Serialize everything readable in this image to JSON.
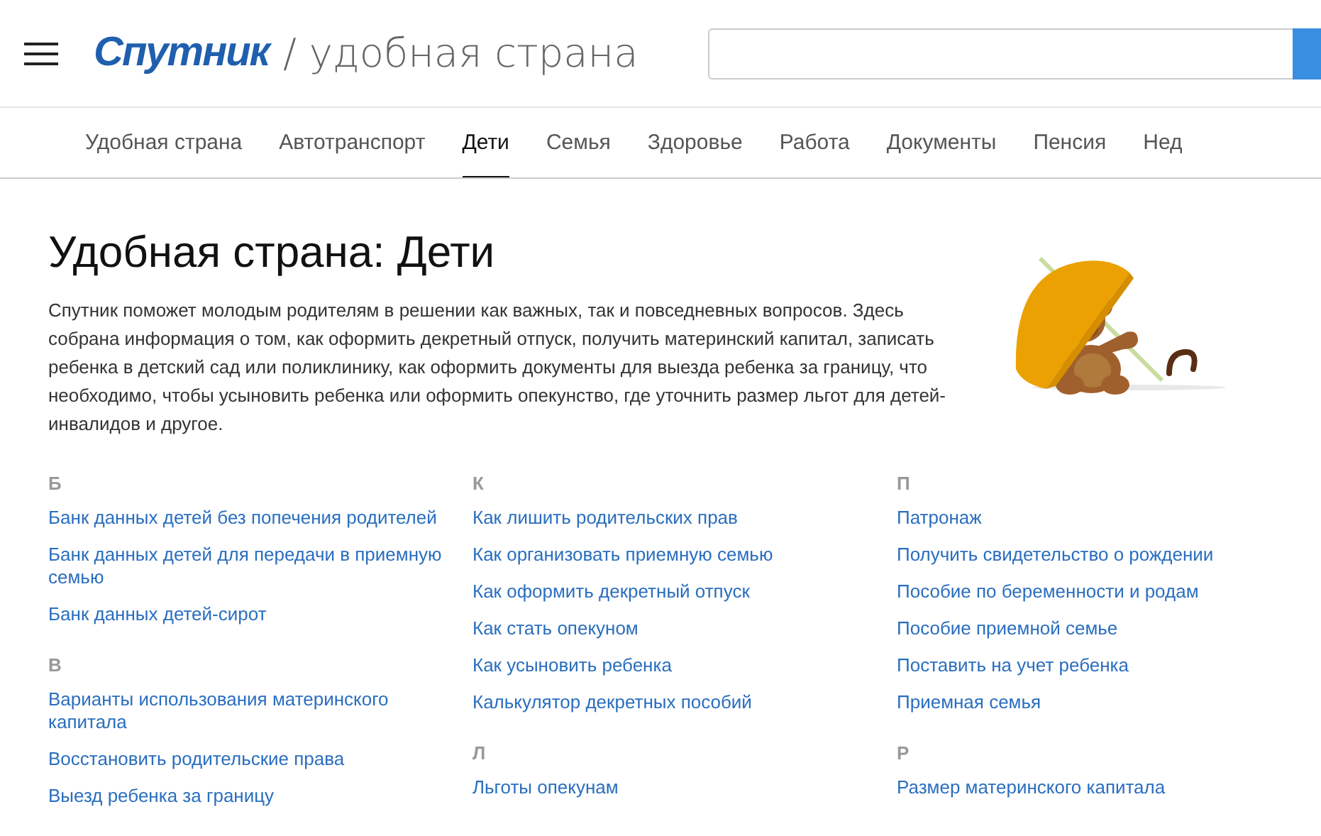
{
  "header": {
    "logo": "Спутник",
    "title": "/ удобная страна"
  },
  "tabs": [
    {
      "label": "Удобная страна",
      "selected": false
    },
    {
      "label": "Автотранспорт",
      "selected": false
    },
    {
      "label": "Дети",
      "selected": true
    },
    {
      "label": "Семья",
      "selected": false
    },
    {
      "label": "Здоровье",
      "selected": false
    },
    {
      "label": "Работа",
      "selected": false
    },
    {
      "label": "Документы",
      "selected": false
    },
    {
      "label": "Пенсия",
      "selected": false
    },
    {
      "label": "Нед",
      "selected": false
    }
  ],
  "intro": {
    "heading": "Удобная страна: Дети",
    "text": "Спутник поможет молодым родителям в решении как важных, так и повседневных вопросов. Здесь собрана информация о том, как оформить декретный отпуск, получить материнский капитал, записать ребенка в детский сад или поликлинику, как оформить документы для выезда ребенка за границу, что необходимо, чтобы усыновить ребенка или оформить опекунство, где уточнить размер льгот для детей-инвалидов и другое."
  },
  "columns": [
    [
      {
        "letter": "Б",
        "links": [
          "Банк данных детей без попечения родителей",
          "Банк данных детей для передачи в приемную семью",
          "Банк данных детей-сирот"
        ]
      },
      {
        "letter": "В",
        "links": [
          "Варианты использования материнского капитала",
          "Восстановить родительские права",
          "Выезд ребенка за границу"
        ]
      }
    ],
    [
      {
        "letter": "К",
        "links": [
          "Как лишить родительских прав",
          "Как организовать приемную семью",
          "Как оформить декретный отпуск",
          "Как стать опекуном",
          "Как усыновить ребенка",
          "Калькулятор декретных пособий"
        ]
      },
      {
        "letter": "Л",
        "links": [
          "Льготы опекунам"
        ]
      }
    ],
    [
      {
        "letter": "П",
        "links": [
          "Патронаж",
          "Получить свидетельство о рождении",
          "Пособие по беременности и родам",
          "Пособие приемной семье",
          "Поставить на учет ребенка",
          "Приемная семья"
        ]
      },
      {
        "letter": "Р",
        "links": [
          "Размер материнского капитала"
        ]
      }
    ]
  ]
}
